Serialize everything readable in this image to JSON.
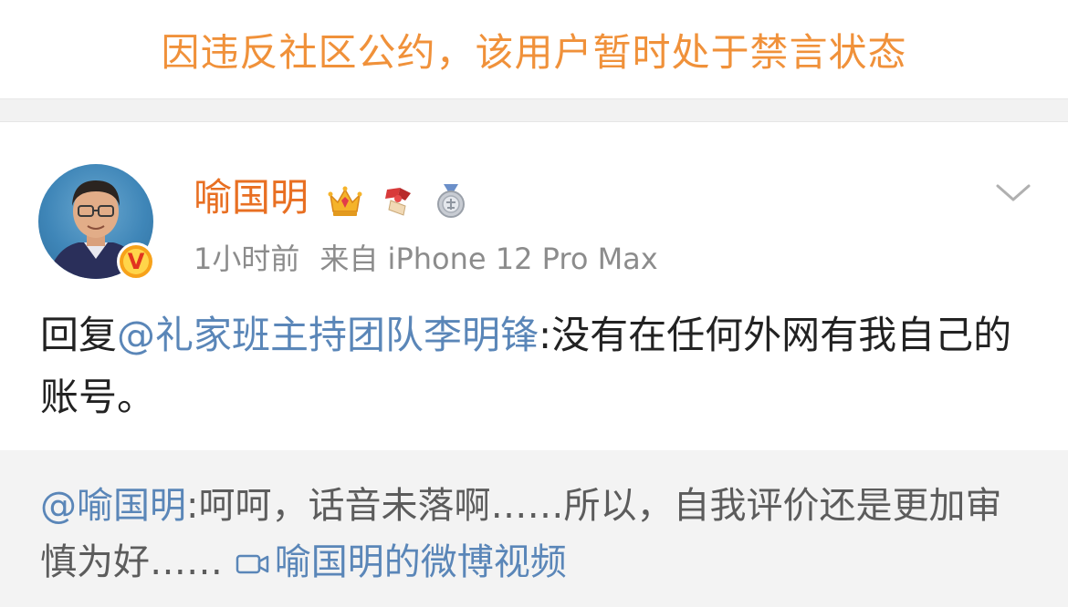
{
  "ban_notice": "因违反社区公约，该用户暂时处于禁言状态",
  "post": {
    "author": {
      "name": "喻国明",
      "verified_mark": "V",
      "avatar_icon": "user-avatar",
      "badges": [
        "crown-badge-icon",
        "scroll-ribbon-badge-icon",
        "medal-badge-icon"
      ]
    },
    "time": "1小时前",
    "source": "来自 iPhone 12 Pro Max",
    "body": {
      "prefix": "回复",
      "mention": "@礼家班主持团队李明锋",
      "text": ":没有在任何外网有我自己的账号。"
    }
  },
  "quoted_reply": {
    "mention": "@喻国明",
    "text": ":呵呵，话音未落啊……所以，自我评价还是更加审慎为好……",
    "video_link": "喻国明的微博视频",
    "video_icon": "video-camera-icon"
  },
  "colors": {
    "ban_notice": "#f0913a",
    "username": "#e86f22",
    "link": "#5a86b8",
    "meta": "#8c8c8c",
    "reply_bg": "#f3f3f3"
  }
}
